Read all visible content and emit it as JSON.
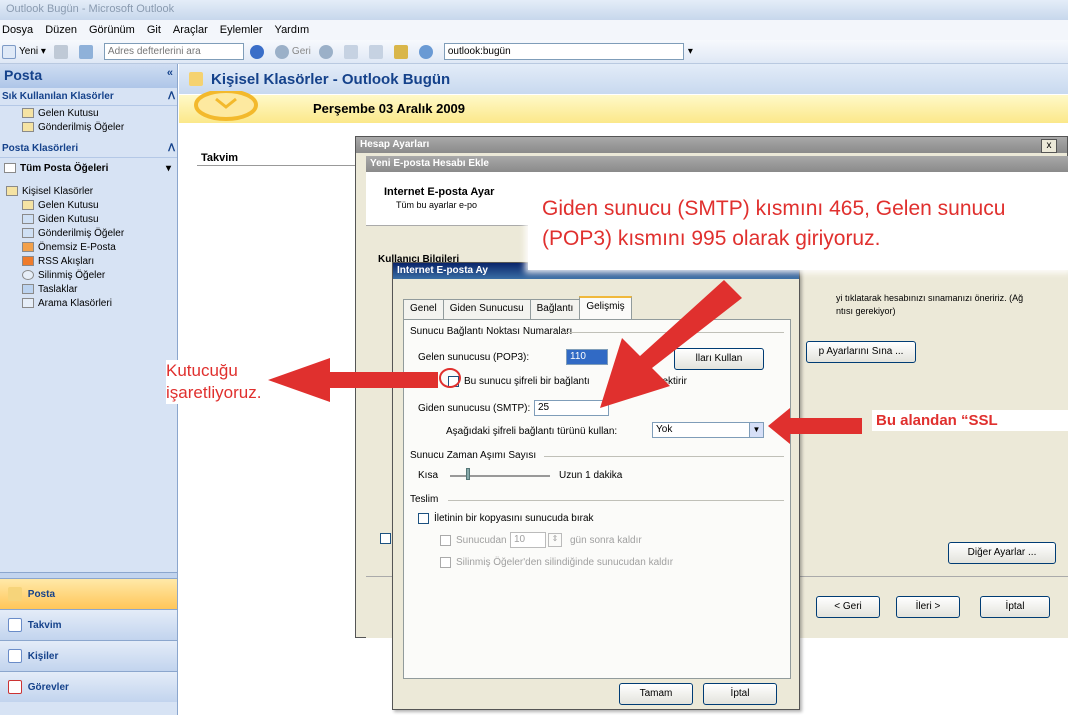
{
  "window": {
    "title": "Outlook Bugün - Microsoft Outlook"
  },
  "menu": [
    "Dosya",
    "Düzen",
    "Görünüm",
    "Git",
    "Araçlar",
    "Eylemler",
    "Yardım"
  ],
  "toolbar": {
    "new_label": "Yeni",
    "address_books": "Adres defterlerini ara",
    "back": "Geri",
    "location": "outlook:bugün"
  },
  "nav": {
    "title": "Posta",
    "fav_header": "Sık Kullanılan Klasörler",
    "favorites": [
      "Gelen Kutusu",
      "Gönderilmiş Öğeler"
    ],
    "mail_header": "Posta Klasörleri",
    "all_items": "Tüm Posta Öğeleri",
    "root": "Kişisel Klasörler",
    "folders": [
      "Gelen Kutusu",
      "Giden Kutusu",
      "Gönderilmiş Öğeler",
      "Önemsiz E-Posta",
      "RSS Akışları",
      "Silinmiş Öğeler",
      "Taslaklar",
      "Arama Klasörleri"
    ],
    "buttons": [
      "Posta",
      "Takvim",
      "Kişiler",
      "Görevler"
    ]
  },
  "main": {
    "title": "Kişisel Klasörler - Outlook Bugün",
    "date": "Perşembe 03 Aralık 2009",
    "calendar": "Takvim"
  },
  "dialog_account": {
    "title": "Hesap Ayarları",
    "subtitle": "Yeni E-posta Hesabı Ekle",
    "section": "Internet E-posta Ayar",
    "section_desc": "Tüm bu ayarlar e-po",
    "user_info": "Kullanıcı Bilgileri",
    "right_text": "yi tıklatarak hesabınızı sınamanızı öneririz. (Ağ",
    "right_text2": "ntısı gerekiyor)",
    "test_button": "p Ayarlarını Sına ...",
    "more_button": "Diğer Ayarlar ...",
    "back_button": "< Geri",
    "next_button": "İleri >",
    "cancel_button": "İptal"
  },
  "dialog_settings": {
    "title": "Internet E-posta Ay",
    "tabs": [
      "Genel",
      "Giden Sunucusu",
      "Bağlantı",
      "Gelişmiş"
    ],
    "ports_group": "Sunucu Bağlantı Noktası Numaraları",
    "incoming_label": "Gelen sunucusu (POP3):",
    "incoming_value": "110",
    "default_button": "lları Kullan",
    "ssl_check": "Bu sunucu şifreli bir bağlantı",
    "ssl_check_tail": "gerektirir",
    "outgoing_label": "Giden sunucusu (SMTP):",
    "outgoing_value": "25",
    "encryption_label": "Aşağıdaki şifreli bağlantı türünü kullan:",
    "encryption_value": "Yok",
    "timeout_group": "Sunucu Zaman Aşımı Sayısı",
    "short": "Kısa",
    "long": "Uzun 1 dakika",
    "delivery_group": "Teslim",
    "leave_copy": "İletinin bir kopyasını sunucuda bırak",
    "remove_after": "Sunucudan",
    "days_value": "10",
    "days_tail": "gün sonra kaldır",
    "remove_deleted": "Silinmiş Öğeler'den silindiğinde sunucudan kaldır",
    "ok": "Tamam",
    "cancel": "İptal"
  },
  "annotations": {
    "callout_top": "Giden sunucu (SMTP) kısmını 465, Gelen sunucu (POP3) kısmını 995 olarak giriyoruz.",
    "checkbox_note_1": "Kutucuğu",
    "checkbox_note_2": "işaretliyoruz.",
    "right_note": "Bu alandan “SSL"
  },
  "colors": {
    "annotation_red": "#e0302e",
    "nav_blue": "#15428b"
  }
}
